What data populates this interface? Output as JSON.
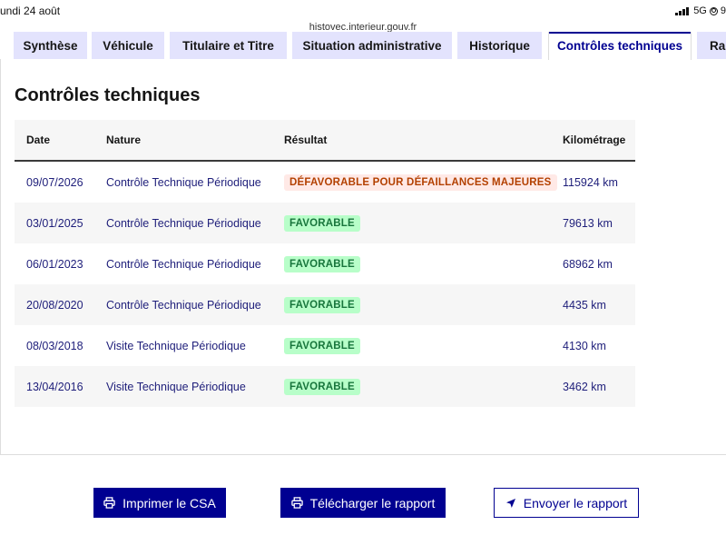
{
  "status_bar": {
    "time": "undi 24 août",
    "network": "5G",
    "battery": "9"
  },
  "browser": {
    "url": "histovec.interieur.gouv.fr"
  },
  "tabs": [
    {
      "label": "Synthèse",
      "active": false
    },
    {
      "label": "Véhicule",
      "active": false
    },
    {
      "label": "Titulaire et Titre",
      "active": false
    },
    {
      "label": "Situation administrative",
      "active": false
    },
    {
      "label": "Historique",
      "active": false
    },
    {
      "label": "Contrôles techniques",
      "active": true
    },
    {
      "label": "Rap",
      "active": false
    }
  ],
  "page": {
    "title": "Contrôles techniques"
  },
  "table": {
    "headers": {
      "date": "Date",
      "nature": "Nature",
      "result": "Résultat",
      "km": "Kilométrage"
    },
    "rows": [
      {
        "date": "09/07/2026",
        "nature": "Contrôle Technique Périodique",
        "result": "DÉFAVORABLE POUR DÉFAILLANCES MAJEURES",
        "result_status": "defavorable",
        "km": "115924 km"
      },
      {
        "date": "03/01/2025",
        "nature": "Contrôle Technique Périodique",
        "result": "FAVORABLE",
        "result_status": "favorable",
        "km": "79613 km"
      },
      {
        "date": "06/01/2023",
        "nature": "Contrôle Technique Périodique",
        "result": "FAVORABLE",
        "result_status": "favorable",
        "km": "68962 km"
      },
      {
        "date": "20/08/2020",
        "nature": "Contrôle Technique Périodique",
        "result": "FAVORABLE",
        "result_status": "favorable",
        "km": "4435 km"
      },
      {
        "date": "08/03/2018",
        "nature": "Visite Technique Périodique",
        "result": "FAVORABLE",
        "result_status": "favorable",
        "km": "4130 km"
      },
      {
        "date": "13/04/2016",
        "nature": "Visite Technique Périodique",
        "result": "FAVORABLE",
        "result_status": "favorable",
        "km": "3462 km"
      }
    ]
  },
  "actions": {
    "print_label": "Imprimer le CSA",
    "download_label": "Télécharger le rapport",
    "send_label": "Envoyer le rapport"
  },
  "colors": {
    "primary": "#000091",
    "tab_bg": "#e3e3fd",
    "favorable_bg": "#b8fec9",
    "favorable_text": "#18753c",
    "defavorable_bg": "#ffe9e6",
    "defavorable_text": "#b34000"
  },
  "icons": {
    "print": "printer-icon",
    "download": "printer-icon",
    "send": "send-arrow-icon"
  }
}
